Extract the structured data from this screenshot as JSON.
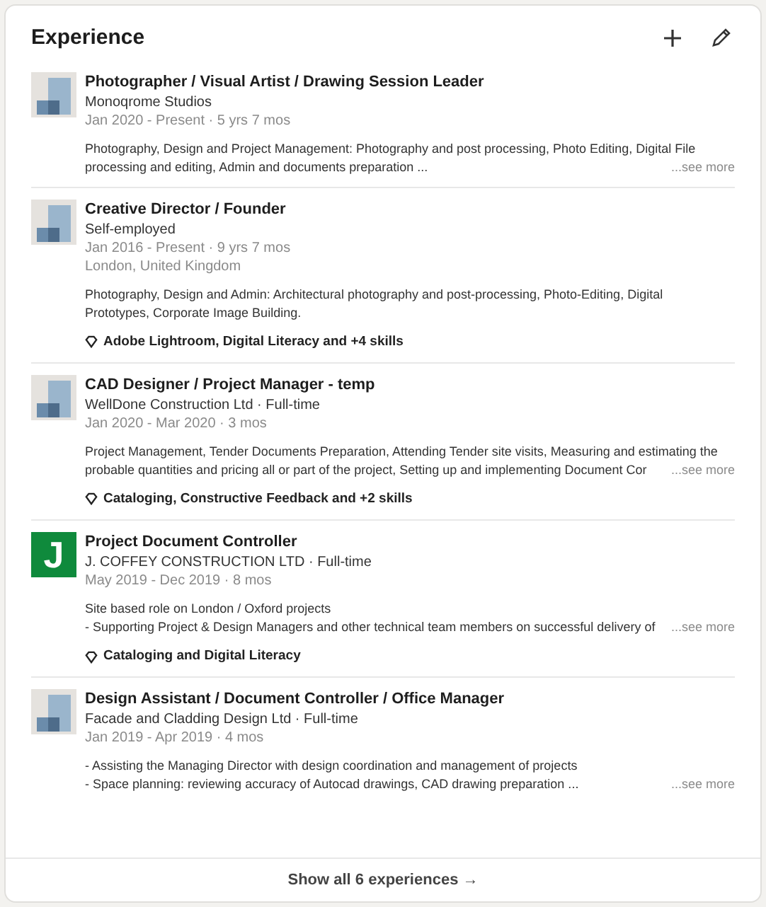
{
  "section": {
    "title": "Experience"
  },
  "entries": [
    {
      "logo": {
        "kind": "placeholder"
      },
      "title": "Photographer / Visual Artist / Drawing Session Leader",
      "company": "Monoqrome Studios",
      "dates": "Jan 2020 - Present · 5 yrs 7 mos",
      "description": [
        "Photography, Design and Project Management: Photography and post processing, Photo Editing, Digital File",
        "processing and editing, Admin and documents preparation ..."
      ],
      "see_more": "...see more"
    },
    {
      "logo": {
        "kind": "placeholder"
      },
      "title": "Creative Director / Founder",
      "company": "Self-employed",
      "dates": "Jan 2016 - Present · 9 yrs 7 mos",
      "location": "London, United Kingdom",
      "description": [
        "Photography, Design and Admin: Architectural photography and post-processing, Photo-Editing, Digital",
        "Prototypes, Corporate Image Building."
      ],
      "skills": "Adobe Lightroom, Digital Literacy and +4 skills"
    },
    {
      "logo": {
        "kind": "placeholder"
      },
      "title": "CAD Designer / Project Manager - temp",
      "company": "WellDone Construction Ltd · Full-time",
      "dates": "Jan 2020 - Mar 2020 · 3 mos",
      "description": [
        "Project Management, Tender Documents Preparation, Attending Tender site visits, Measuring and estimating the",
        "probable quantities and pricing all or part of the project, Setting up and implementing Document Cor"
      ],
      "see_more": "...see more",
      "skills": "Cataloging, Constructive Feedback and +2 skills"
    },
    {
      "logo": {
        "kind": "letter",
        "letter": "J",
        "color": "#0f8a3c"
      },
      "title": "Project Document Controller",
      "company": "J. COFFEY CONSTRUCTION LTD · Full-time",
      "dates": "May 2019 - Dec 2019 · 8 mos",
      "description": [
        "Site based role on London / Oxford projects",
        "- Supporting Project & Design Managers and other technical team members on successful delivery of"
      ],
      "see_more": "...see more",
      "skills": "Cataloging and Digital Literacy"
    },
    {
      "logo": {
        "kind": "placeholder"
      },
      "title": "Design Assistant / Document Controller / Office Manager",
      "company": "Facade and Cladding Design Ltd · Full-time",
      "dates": "Jan 2019 - Apr 2019 · 4 mos",
      "description": [
        "- Assisting the Managing Director with design coordination and management of projects",
        "- Space planning: reviewing accuracy of Autocad drawings, CAD drawing preparation ..."
      ],
      "see_more": "...see more"
    }
  ],
  "footer": {
    "label": "Show all 6 experiences →"
  }
}
